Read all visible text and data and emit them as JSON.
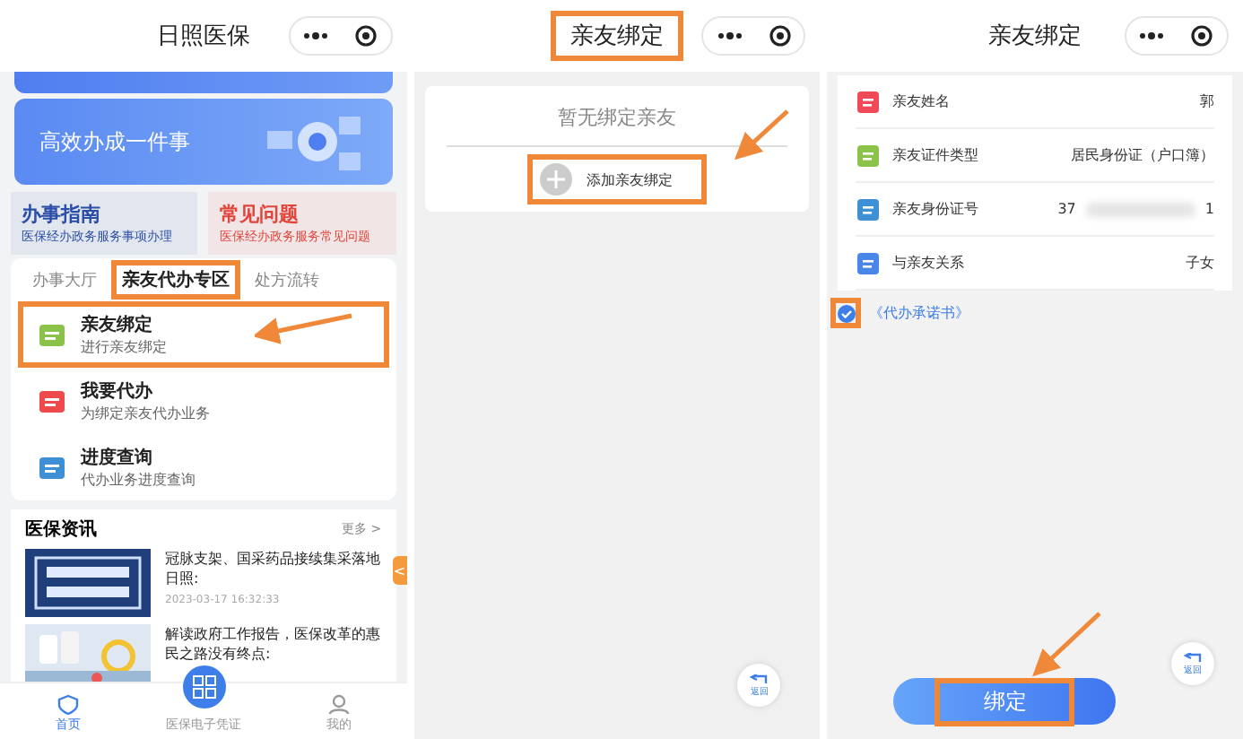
{
  "home": {
    "title": "日照医保",
    "banner": {
      "headline": "高效办成一件事"
    },
    "cards": [
      {
        "title": "办事指南",
        "subtitle": "医保经办政务服务事项办理",
        "color": "#2b4fa8"
      },
      {
        "title": "常见问题",
        "subtitle": "医保经办政务服务常见问题",
        "color": "#e0463c"
      }
    ],
    "tabs": [
      {
        "label": "办事大厅",
        "selected": false,
        "highlighted": false
      },
      {
        "label": "亲友代办专区",
        "selected": true,
        "highlighted": true
      },
      {
        "label": "处方流转",
        "selected": false,
        "highlighted": false
      }
    ],
    "services": [
      {
        "title": "亲友绑定",
        "subtitle": "进行亲友绑定",
        "color": "#8bc34a",
        "highlighted": true
      },
      {
        "title": "我要代办",
        "subtitle": "为绑定亲友代办业务",
        "color": "#ef4b4b",
        "highlighted": false
      },
      {
        "title": "进度查询",
        "subtitle": "代办业务进度查询",
        "color": "#3d8fd6",
        "highlighted": false
      }
    ],
    "news": {
      "title": "医保资讯",
      "more": "更多 >",
      "items": [
        {
          "headline": "冠脉支架、国采药品接续集采落地日照:",
          "time": "2023-03-17 16:32:33"
        },
        {
          "headline": "解读政府工作报告，医保改革的惠民之路没有终点:"
        }
      ]
    },
    "side_tab": "<",
    "tabbar": [
      {
        "label": "首页",
        "selected": true
      },
      {
        "label": "医保电子凭证",
        "selected": false
      },
      {
        "label": "我的",
        "selected": false
      }
    ]
  },
  "binding_list": {
    "title": "亲友绑定",
    "title_highlighted": true,
    "empty_text": "暂无绑定亲友",
    "add_label": "添加亲友绑定",
    "add_highlighted": true,
    "back_label": "返回"
  },
  "binding_form": {
    "title": "亲友绑定",
    "fields": [
      {
        "label": "亲友姓名",
        "value": "郭",
        "color": "#f04a5a"
      },
      {
        "label": "亲友证件类型",
        "value": "居民身份证（户口簿）",
        "color": "#8bc34a"
      },
      {
        "label": "亲友身份证号",
        "value": "37",
        "value_end": "1",
        "color": "#3d8fd6"
      },
      {
        "label": "与亲友关系",
        "value": "子女",
        "color": "#4a86e8"
      }
    ],
    "agreement": {
      "label": "《代办承诺书》",
      "checked": true,
      "highlighted": true
    },
    "submit": {
      "label": "绑定",
      "highlighted": true
    },
    "back_label": "返回"
  }
}
